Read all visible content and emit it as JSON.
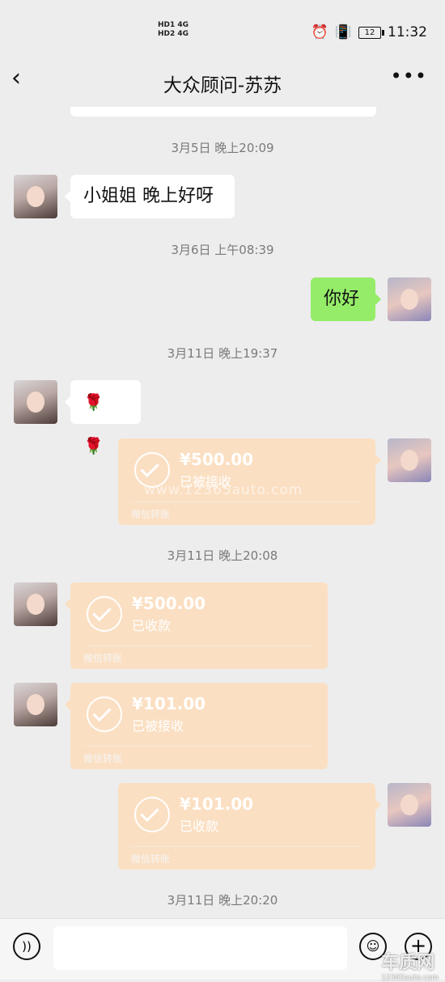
{
  "status_bar": {
    "network_top": "HD1 4G",
    "network_bottom": "HD2 4G",
    "battery": "12",
    "time": "11:32"
  },
  "header": {
    "title": "大众顾问-苏苏",
    "back_icon": "chevron-left-icon",
    "more_icon": "more-dots-icon"
  },
  "messages": [
    {
      "type": "time",
      "text": "3月5日 晚上20:09"
    },
    {
      "type": "text",
      "side": "left",
      "text": "小姐姐 晚上好呀"
    },
    {
      "type": "time",
      "text": "3月6日 上午08:39"
    },
    {
      "type": "text",
      "side": "right",
      "text": "你好"
    },
    {
      "type": "time",
      "text": "3月11日 晚上19:37"
    },
    {
      "type": "emoji",
      "side": "left",
      "text": "🌹🌹"
    },
    {
      "type": "transfer",
      "side": "right",
      "amount": "¥500.00",
      "status": "已被接收",
      "footer": "微信转账"
    },
    {
      "type": "time",
      "text": "3月11日 晚上20:08"
    },
    {
      "type": "transfer",
      "side": "left",
      "amount": "¥500.00",
      "status": "已收款",
      "footer": "微信转账"
    },
    {
      "type": "transfer",
      "side": "left",
      "amount": "¥101.00",
      "status": "已被接收",
      "footer": "微信转账"
    },
    {
      "type": "transfer",
      "side": "right",
      "amount": "¥101.00",
      "status": "已收款",
      "footer": "微信转账"
    },
    {
      "type": "time",
      "text": "3月11日 晚上20:20"
    }
  ],
  "watermark": "www.12365auto.com",
  "logo": {
    "name": "车质网",
    "site": "12365auto.com"
  },
  "input_bar": {
    "voice_icon": "voice-icon",
    "emoji_icon": "emoji-icon",
    "plus_icon": "plus-icon"
  },
  "colors": {
    "background": "#ededed",
    "green_bubble": "#95ec69",
    "transfer_bubble": "#fbdfc2"
  }
}
